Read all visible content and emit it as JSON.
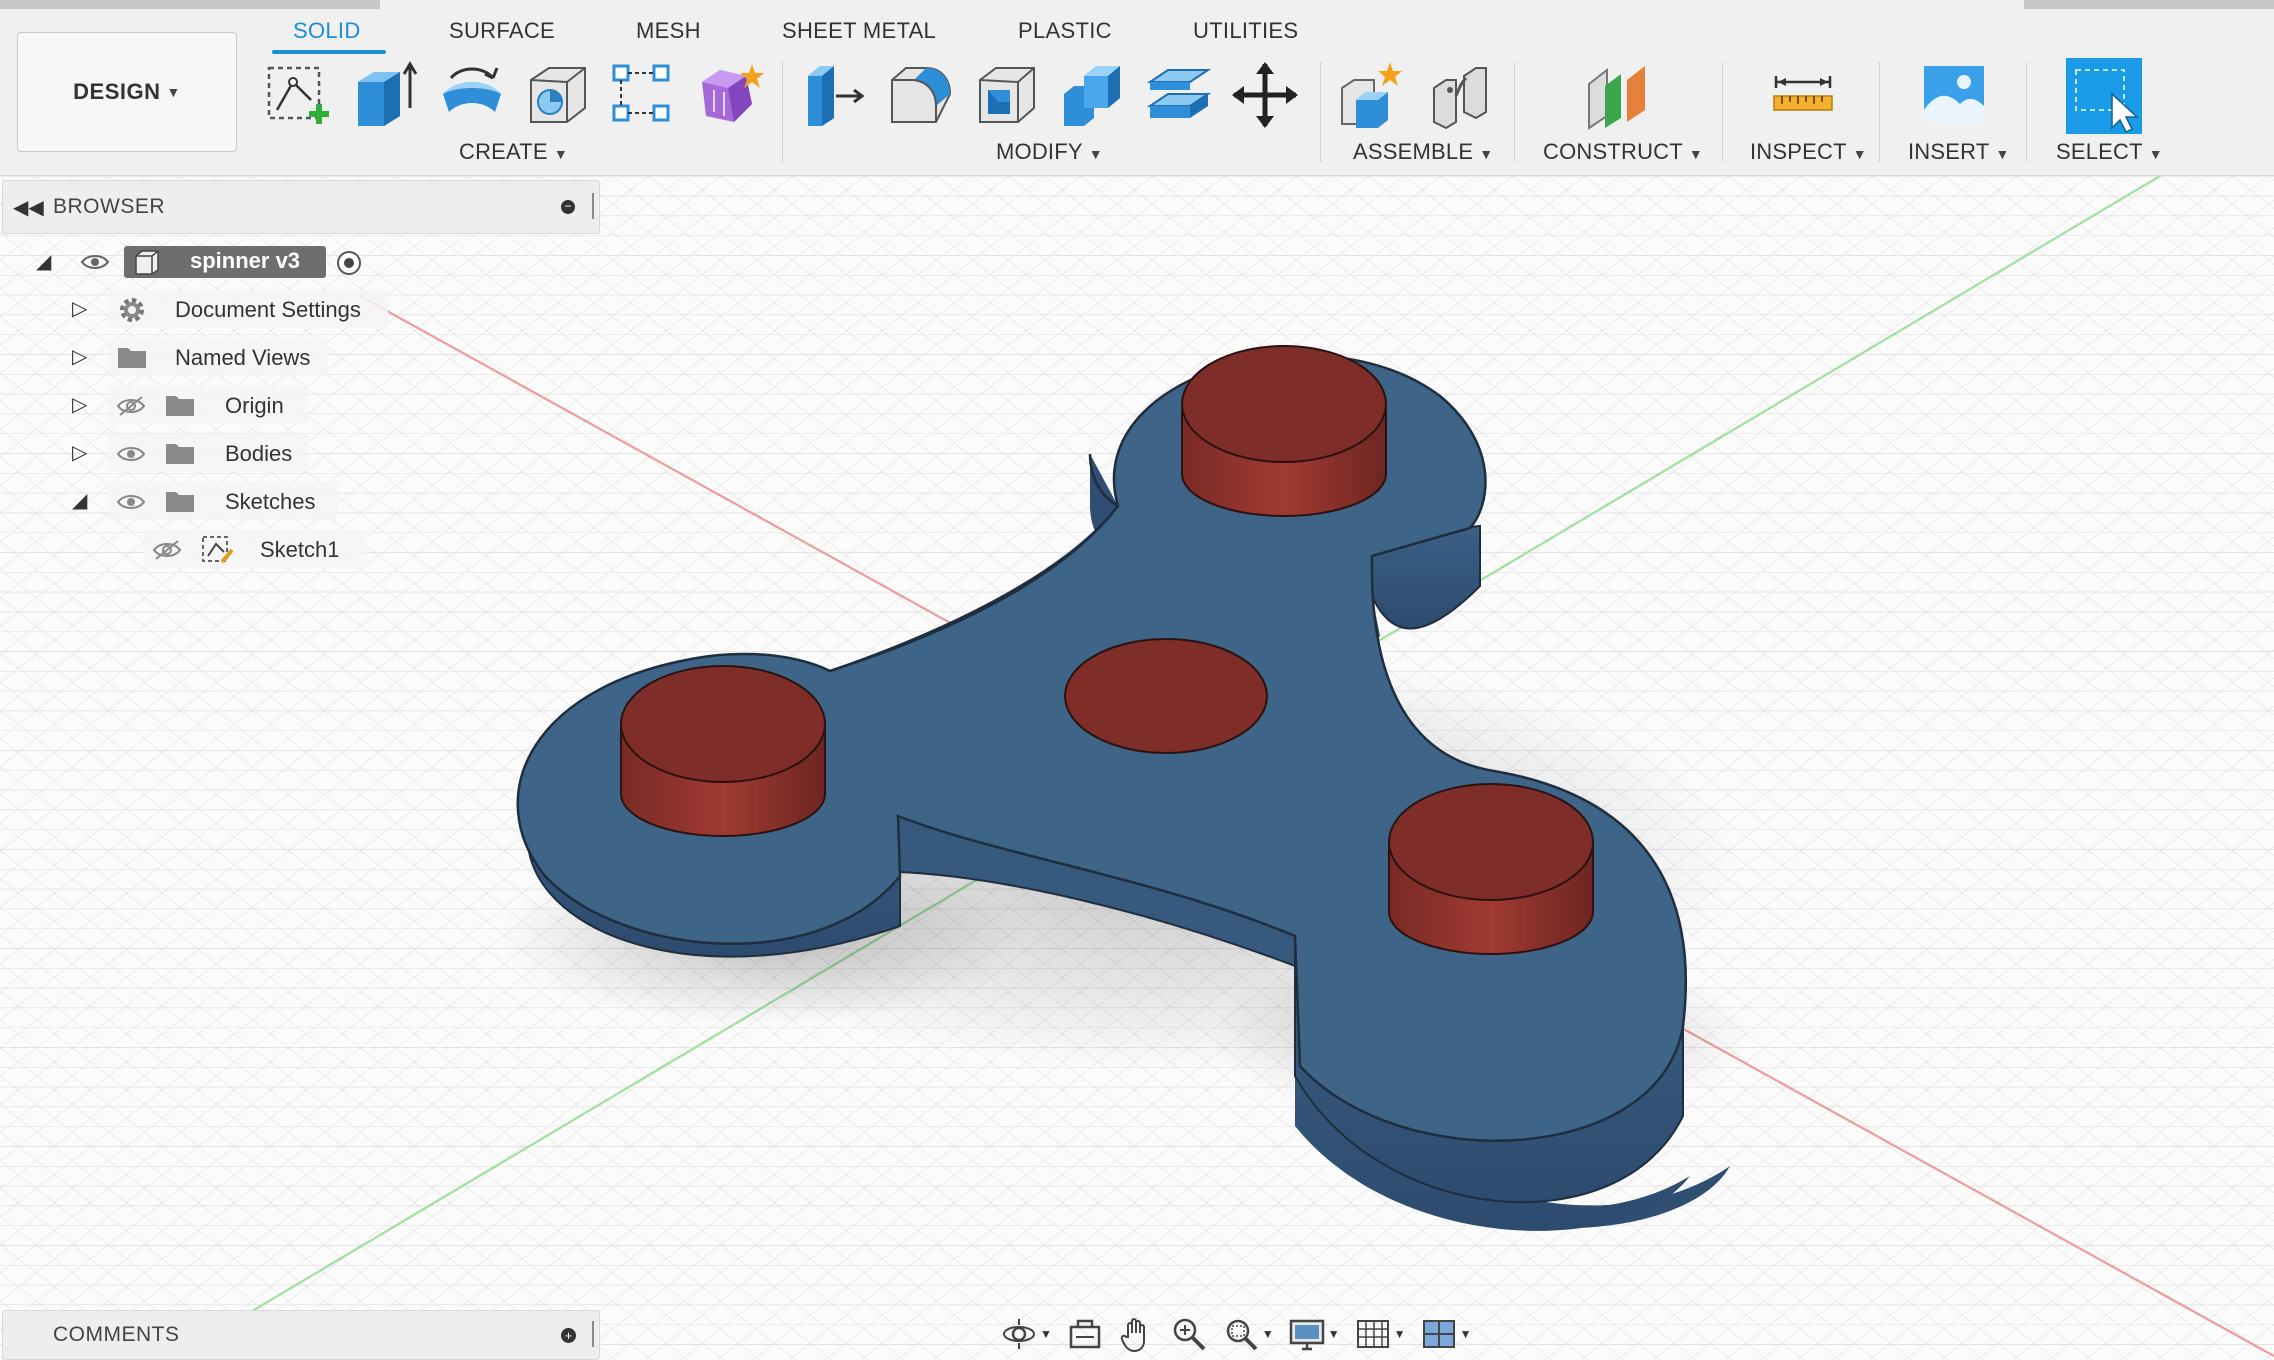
{
  "workspace": {
    "label": "DESIGN"
  },
  "tabs": [
    {
      "label": "SOLID",
      "active": true
    },
    {
      "label": "SURFACE"
    },
    {
      "label": "MESH"
    },
    {
      "label": "SHEET METAL"
    },
    {
      "label": "PLASTIC"
    },
    {
      "label": "UTILITIES"
    }
  ],
  "groups": {
    "create": "CREATE",
    "modify": "MODIFY",
    "assemble": "ASSEMBLE",
    "construct": "CONSTRUCT",
    "inspect": "INSPECT",
    "insert": "INSERT",
    "select": "SELECT"
  },
  "browser": {
    "title": "BROWSER",
    "root": "spinner v3",
    "items": [
      {
        "label": "Document Settings"
      },
      {
        "label": "Named Views"
      },
      {
        "label": "Origin"
      },
      {
        "label": "Bodies"
      },
      {
        "label": "Sketches"
      },
      {
        "label": "Sketch1"
      }
    ]
  },
  "comments": {
    "title": "COMMENTS"
  },
  "colors": {
    "accent": "#1a8fd6",
    "body": "#3e6487",
    "bearing": "#7e2d28"
  }
}
